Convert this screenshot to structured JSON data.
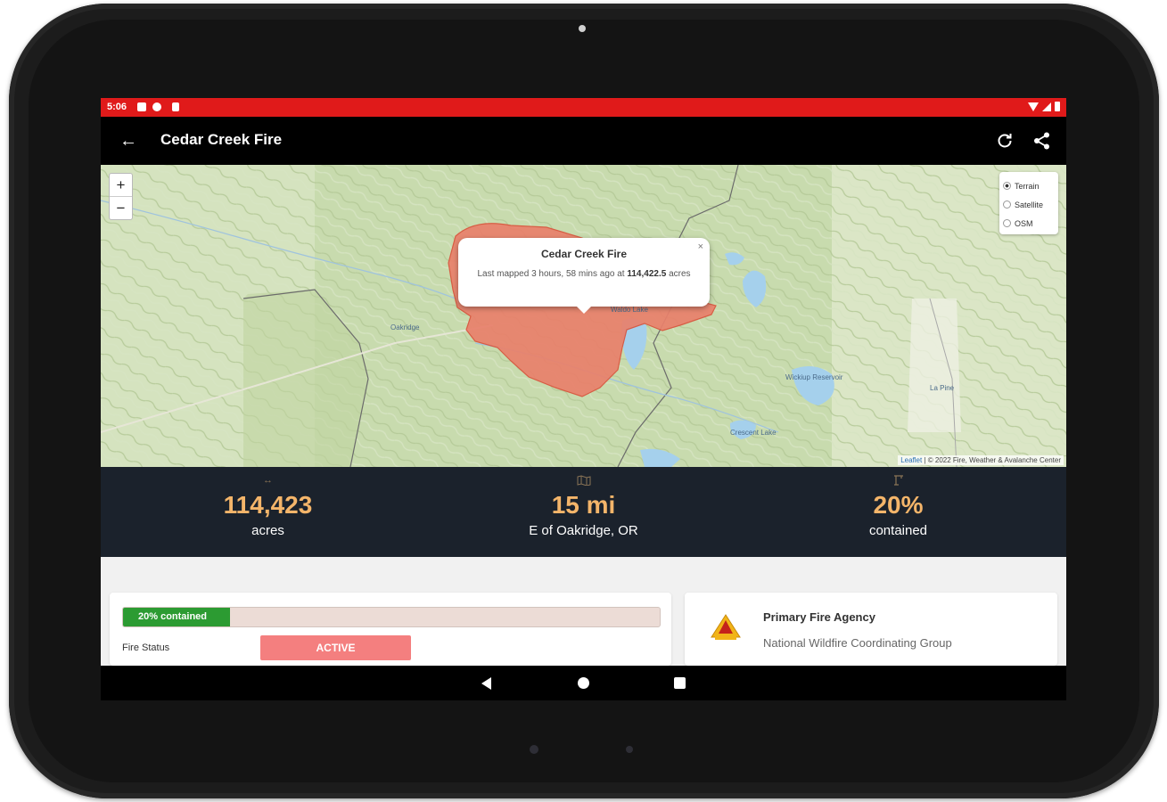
{
  "status_bar": {
    "time": "5:06"
  },
  "app_bar": {
    "title": "Cedar Creek Fire"
  },
  "map": {
    "zoom_in": "+",
    "zoom_out": "−",
    "layers": [
      "Terrain",
      "Satellite",
      "OSM"
    ],
    "selected_layer": "Terrain",
    "popup": {
      "title": "Cedar Creek Fire",
      "desc_prefix": "Last mapped 3 hours, 58 mins ago at",
      "acres_value": "114,422.5",
      "desc_suffix": "acres",
      "close": "×"
    },
    "labels": {
      "oakridge": "Oakridge",
      "waldo_lake": "Waldo Lake",
      "la_pine": "La Pine",
      "wickiup": "Wickiup Reservoir",
      "crescent": "Crescent Lake"
    },
    "attribution_link": "Leaflet",
    "attribution_text": "| © 2022 Fire, Weather & Avalanche Center",
    "colors": {
      "fire_fill": "#e9806b",
      "fire_stroke": "#d9533c"
    }
  },
  "stats": [
    {
      "icon": "arrows-icon",
      "value": "114,423",
      "label": "acres"
    },
    {
      "icon": "map-icon",
      "value": "15 mi",
      "label": "E of Oakridge, OR"
    },
    {
      "icon": "crane-icon",
      "value": "20%",
      "label": "contained"
    }
  ],
  "containment": {
    "percent": 20,
    "label": "20% contained"
  },
  "fire_status": {
    "label": "Fire Status",
    "value": "ACTIVE"
  },
  "agency": {
    "heading": "Primary Fire Agency",
    "name": "National Wildfire Coordinating Group"
  },
  "colors": {
    "accent": "#e01a1a",
    "stat_value": "#f4b56a",
    "progress": "#2c9b32",
    "active_badge": "#f47f7f",
    "stats_band": "#1b222c"
  }
}
